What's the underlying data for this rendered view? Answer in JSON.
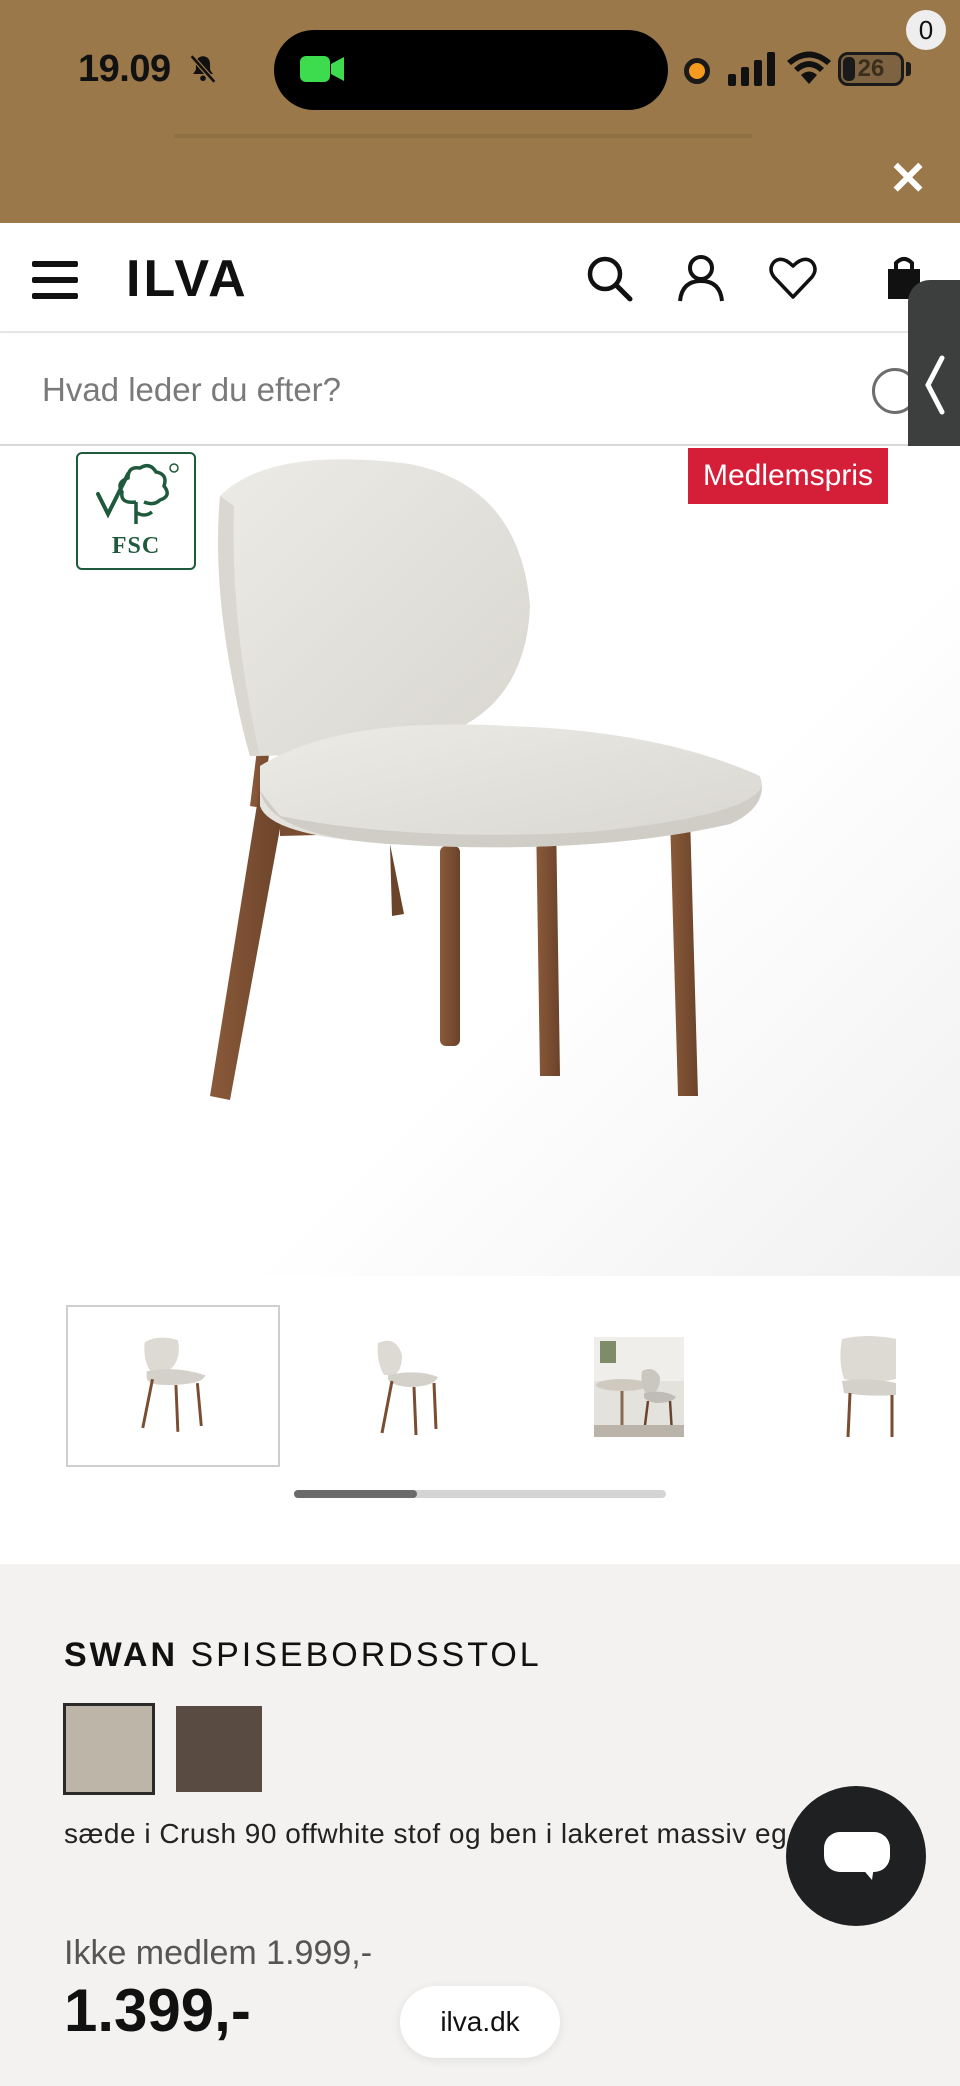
{
  "status_bar": {
    "time": "19.09",
    "battery": "26",
    "icons": [
      "bell-muted-icon",
      "facetime-camera-icon",
      "mic-indicator-icon",
      "signal-icon",
      "wifi-icon",
      "battery-icon"
    ]
  },
  "banner": {
    "close_icon": "close-icon",
    "close_symbol": "✕"
  },
  "header": {
    "logo": "ILVA",
    "cart_count": "0",
    "icons": [
      "menu-icon",
      "search-icon",
      "account-icon",
      "heart-icon",
      "bag-icon"
    ]
  },
  "search": {
    "placeholder": "Hvad leder du efter?"
  },
  "product_image": {
    "badge": "Medlemspris",
    "certification": "FSC"
  },
  "thumbnails": {
    "count": 4,
    "active_index": 0,
    "scroll_position": 0.33
  },
  "product": {
    "name_bold": "SWAN",
    "name_rest": "SPISEBORDSSTOL",
    "swatches": [
      "#bdb5a8",
      "#5a4b42"
    ],
    "selected_swatch": 0,
    "description": "sæde i Crush 90 offwhite stof og ben i lakeret massiv eg",
    "price_non_member": "Ikke medlem 1.999,-",
    "price_member": "1.399,-"
  },
  "browser": {
    "url": "ilva.dk"
  },
  "colors": {
    "banner": "#9b7849",
    "badge": "#d51e38",
    "details_bg": "#f3f2f0"
  }
}
